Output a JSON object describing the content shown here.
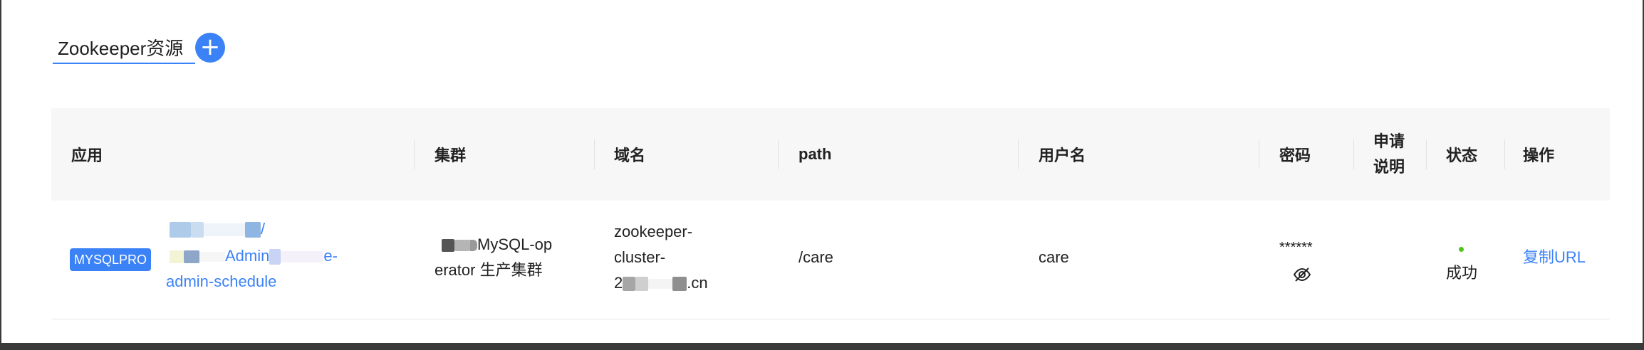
{
  "section": {
    "title": "Zookeeper资源",
    "add_label": "+"
  },
  "table": {
    "columns": [
      "应用",
      "集群",
      "域名",
      "path",
      "用户名",
      "密码",
      "申请说明",
      "状态",
      "操作"
    ],
    "rows": [
      {
        "app_tag": "MYSQLPRO",
        "app_line1": "/",
        "app_line2_mid": "Admin",
        "app_line2_end": "e-",
        "app_line3": "admin-schedule",
        "cluster_line1": "MySQL-op",
        "cluster_line2": "erator 生产集群",
        "domain_line1": "zookeeper-",
        "domain_line2": "cluster-",
        "domain_line3_start": "2",
        "domain_line3_end": ".cn",
        "path": "/care",
        "username": "care",
        "password": "******",
        "status": "成功",
        "action": "复制URL"
      }
    ]
  },
  "colors": {
    "accent": "#3b82f6",
    "status_success": "#52c41a",
    "header_bg": "#f7f7f7"
  },
  "icons": {
    "add": "plus-icon",
    "password_toggle": "eye-slash-icon",
    "status": "status-dot-icon"
  }
}
